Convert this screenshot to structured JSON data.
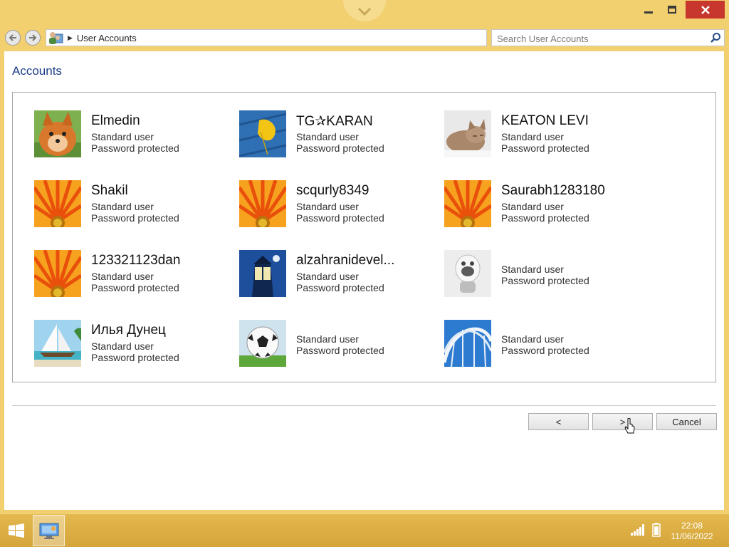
{
  "window": {
    "breadcrumb": "User Accounts",
    "search_placeholder": "Search User Accounts",
    "controls": {
      "minimize": "minimize-icon",
      "maximize": "maximize-icon",
      "close": "close-icon"
    }
  },
  "page": {
    "heading": "Accounts"
  },
  "accounts": [
    {
      "name": "Elmedin",
      "type": "Standard user",
      "status": "Password protected",
      "picture": "pomeranian-dog"
    },
    {
      "name": "TG✰KARAN",
      "type": "Standard user",
      "status": "Password protected",
      "picture": "yellow-leaf-on-blue-wood"
    },
    {
      "name": "KEATON LEVI",
      "type": "Standard user",
      "status": "Password protected",
      "picture": "sleeping-kitten"
    },
    {
      "name": "Shakil",
      "type": "Standard user",
      "status": "Password protected",
      "picture": "orange-flower"
    },
    {
      "name": "scqurly8349",
      "type": "Standard user",
      "status": "Password protected",
      "picture": "orange-flower"
    },
    {
      "name": "Saurabh1283180",
      "type": "Standard user",
      "status": "Password protected",
      "picture": "orange-flower"
    },
    {
      "name": "123321123dan",
      "type": "Standard user",
      "status": "Password protected",
      "picture": "orange-flower"
    },
    {
      "name": "alzahranidevel...",
      "type": "Standard user",
      "status": "Password protected",
      "picture": "lighthouse"
    },
    {
      "name": "",
      "type": "Standard user",
      "status": "Password protected",
      "picture": "robot-figure"
    },
    {
      "name": "Илья Дунец",
      "type": "Standard user",
      "status": "Password protected",
      "picture": "sailboat-beach"
    },
    {
      "name": "",
      "type": "Standard user",
      "status": "Password protected",
      "picture": "soccer-ball"
    },
    {
      "name": "",
      "type": "Standard user",
      "status": "Password protected",
      "picture": "roller-coaster"
    }
  ],
  "buttons": {
    "prev": "<",
    "next": ">",
    "cancel": "Cancel"
  },
  "taskbar": {
    "time": "22:08",
    "date": "11/06/2022"
  },
  "colors": {
    "accent_heading": "#1e3e8a",
    "frame": "#f2d070",
    "close_button": "#c7372d"
  }
}
